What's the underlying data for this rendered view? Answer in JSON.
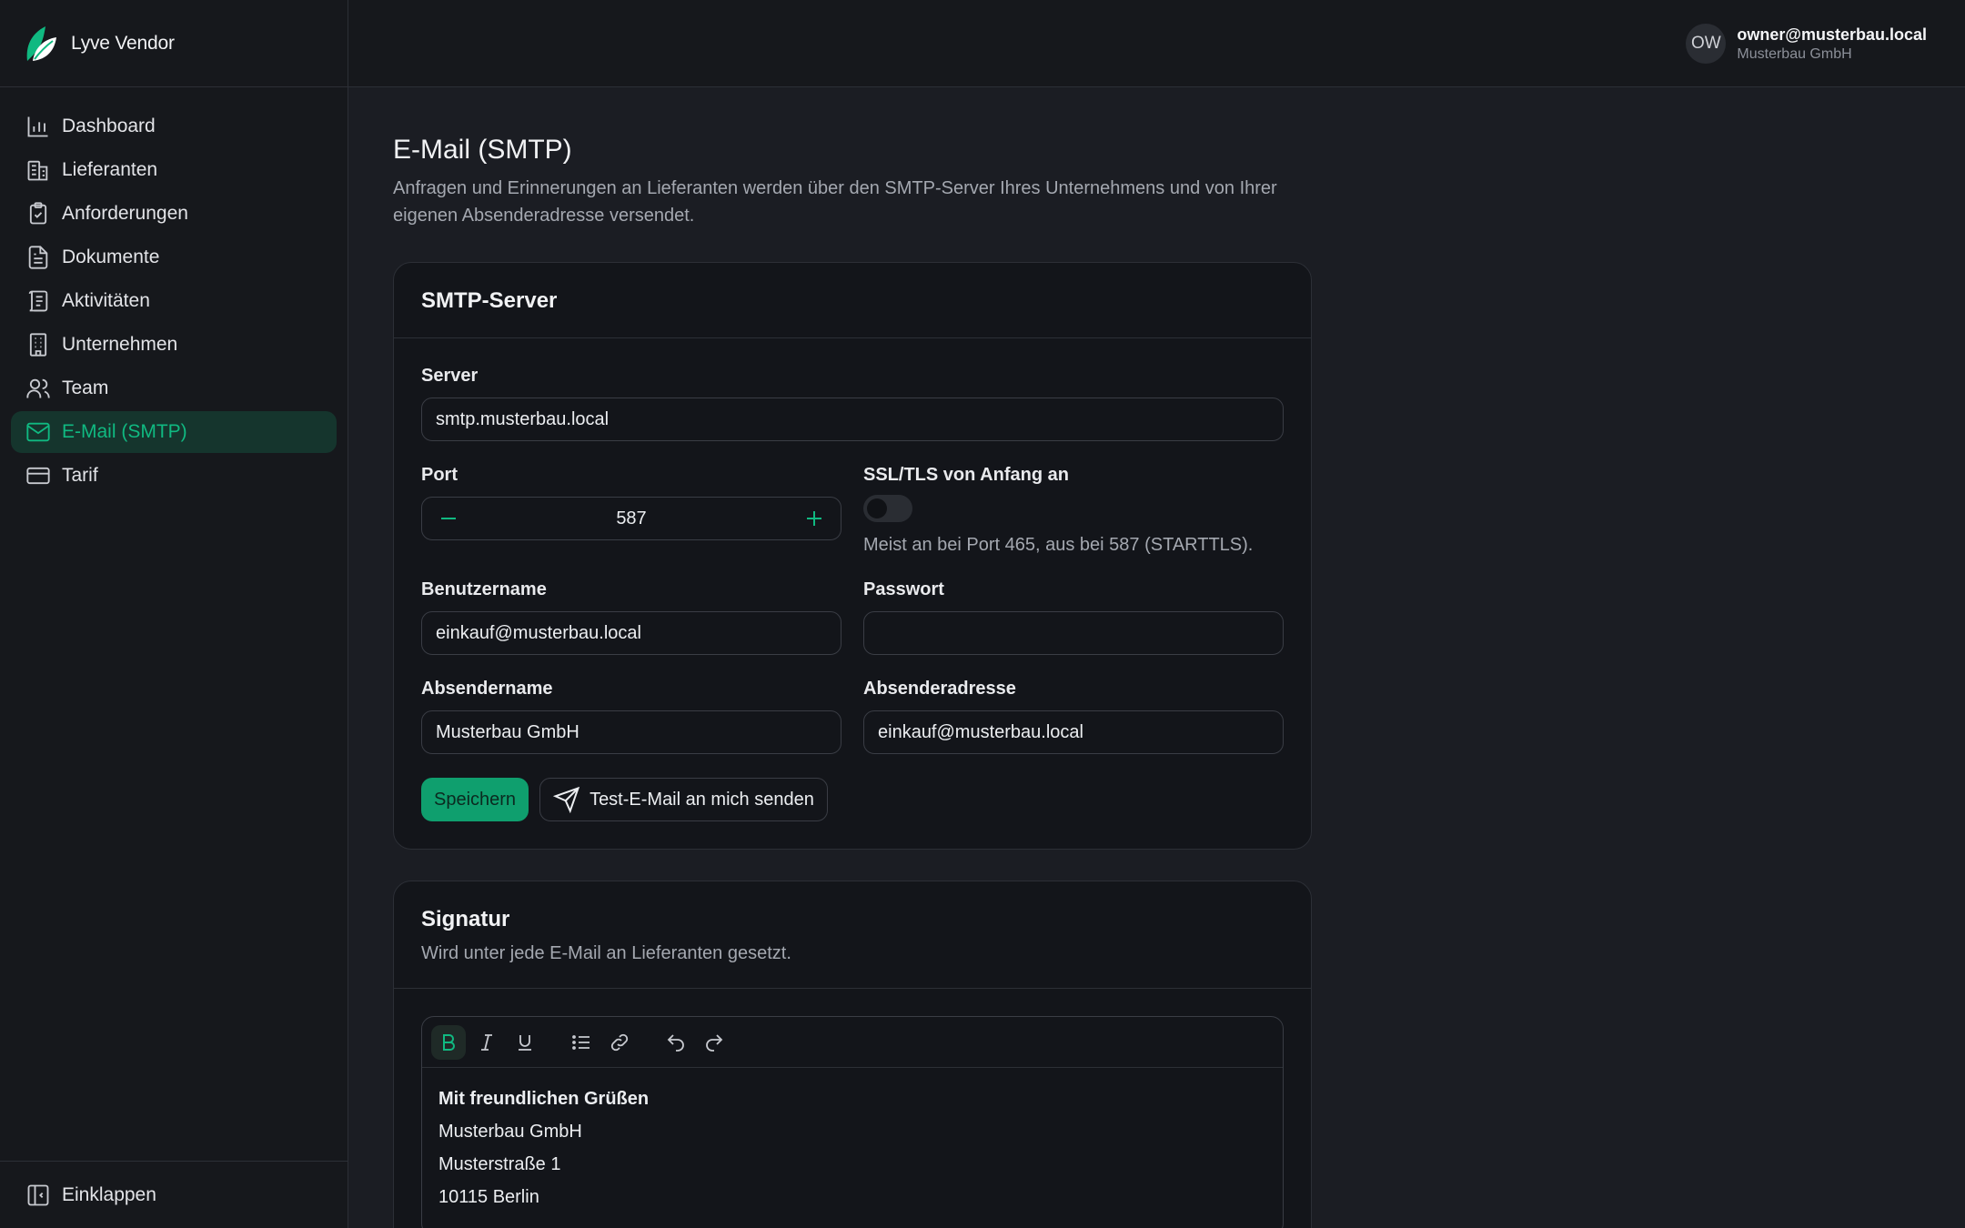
{
  "brand": {
    "name": "Lyve Vendor"
  },
  "sidebar": {
    "items": [
      {
        "label": "Dashboard",
        "icon": "bar-chart-icon"
      },
      {
        "label": "Lieferanten",
        "icon": "building-store-icon"
      },
      {
        "label": "Anforderungen",
        "icon": "clipboard-check-icon"
      },
      {
        "label": "Dokumente",
        "icon": "document-icon"
      },
      {
        "label": "Aktivitäten",
        "icon": "scroll-icon"
      },
      {
        "label": "Unternehmen",
        "icon": "office-building-icon"
      },
      {
        "label": "Team",
        "icon": "users-icon"
      },
      {
        "label": "E-Mail (SMTP)",
        "icon": "mail-icon",
        "active": true
      },
      {
        "label": "Tarif",
        "icon": "credit-card-icon"
      }
    ],
    "collapse_label": "Einklappen"
  },
  "user": {
    "initials": "OW",
    "email": "owner@musterbau.local",
    "company": "Musterbau GmbH"
  },
  "page": {
    "title": "E-Mail (SMTP)",
    "description": "Anfragen und Erinnerungen an Lieferanten werden über den SMTP-Server Ihres Unternehmens und von Ihrer eigenen Absenderadresse versendet."
  },
  "smtp": {
    "title": "SMTP-Server",
    "server_label": "Server",
    "server_value": "smtp.musterbau.local",
    "port_label": "Port",
    "port_value": "587",
    "ssl_label": "SSL/TLS von Anfang an",
    "ssl_enabled": false,
    "ssl_hint": "Meist an bei Port 465, aus bei 587 (STARTTLS).",
    "username_label": "Benutzername",
    "username_value": "einkauf@musterbau.local",
    "password_label": "Passwort",
    "password_value": "",
    "sender_name_label": "Absendername",
    "sender_name_value": "Musterbau GmbH",
    "sender_address_label": "Absenderadresse",
    "sender_address_value": "einkauf@musterbau.local",
    "save_label": "Speichern",
    "test_label": "Test-E-Mail an mich senden"
  },
  "signature": {
    "title": "Signatur",
    "subtitle": "Wird unter jede E-Mail an Lieferanten gesetzt.",
    "lines": [
      "Mit freundlichen Grüßen",
      "Musterbau GmbH",
      "Musterstraße 1",
      "10115 Berlin"
    ]
  },
  "colors": {
    "accent": "#10b981",
    "active_bg": "#15352d",
    "primary_button": "#0f9f6e"
  }
}
